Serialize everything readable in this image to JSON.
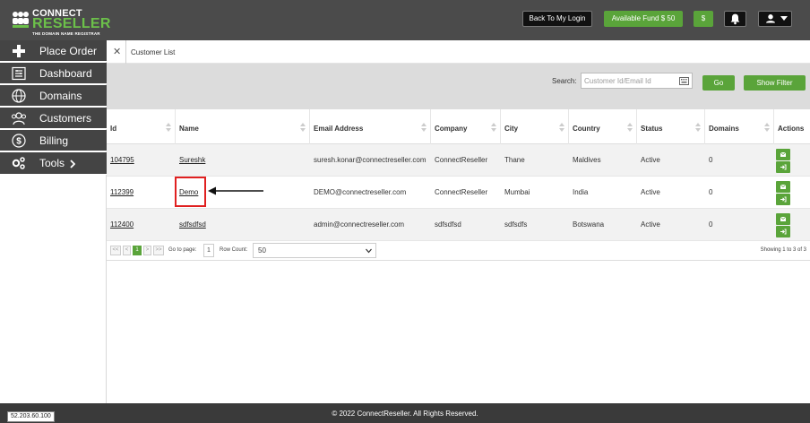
{
  "brand": {
    "line1": "CONNECT",
    "line2": "RESELLER",
    "tagline": "THE DOMAIN NAME REGISTRAR"
  },
  "topbar": {
    "back_label": "Back To My Login",
    "fund_label": "Available Fund",
    "fund_amount": "$ 50",
    "dollar_label": "$"
  },
  "sidebar": {
    "items": [
      {
        "label": "Place Order",
        "icon": "plus-icon"
      },
      {
        "label": "Dashboard",
        "icon": "dashboard-icon"
      },
      {
        "label": "Domains",
        "icon": "globe-icon"
      },
      {
        "label": "Customers",
        "icon": "users-icon"
      },
      {
        "label": "Billing",
        "icon": "dollar-icon"
      },
      {
        "label": "Tools",
        "icon": "gears-icon"
      }
    ]
  },
  "tab": {
    "close": "✕",
    "label": "Customer List"
  },
  "filter": {
    "search_label": "Search:",
    "search_placeholder": "Customer Id/Email Id",
    "go_label": "Go",
    "show_filter_label": "Show Filter"
  },
  "table": {
    "columns": [
      "Id",
      "Name",
      "Email Address",
      "Company",
      "City",
      "Country",
      "Status",
      "Domains",
      "Actions"
    ],
    "rows": [
      {
        "id": "104795",
        "name": "Sureshk",
        "email": "suresh.konar@connectreseller.com",
        "company": "ConnectReseller",
        "city": "Thane",
        "country": "Maldives",
        "status": "Active",
        "domains": "0"
      },
      {
        "id": "112399",
        "name": "Demo",
        "email": "DEMO@connectreseller.com",
        "company": "ConnectReseller",
        "city": "Mumbai",
        "country": "India",
        "status": "Active",
        "domains": "0"
      },
      {
        "id": "112400",
        "name": "sdfsdfsd",
        "email": "admin@connectreseller.com",
        "company": "sdfsdfsd",
        "city": "sdfsdfs",
        "country": "Botswana",
        "status": "Active",
        "domains": "0"
      }
    ]
  },
  "pager": {
    "first": "<<",
    "prev": "<",
    "current": "1",
    "next": ">",
    "last": ">>",
    "goto_label": "Go to page:",
    "goto_value": "1",
    "rowcount_label": "Row Count:",
    "rowcount_value": "50",
    "showing": "Showing 1 to 3 of 3"
  },
  "footer": {
    "copyright": "© 2022 ConnectReseller. All Rights Reserved.",
    "ip": "52.203.60.100"
  },
  "colors": {
    "accent": "#5aa43a",
    "topbar": "#4b4b4b",
    "sidebar": "#444444",
    "highlight": "#e02020"
  }
}
